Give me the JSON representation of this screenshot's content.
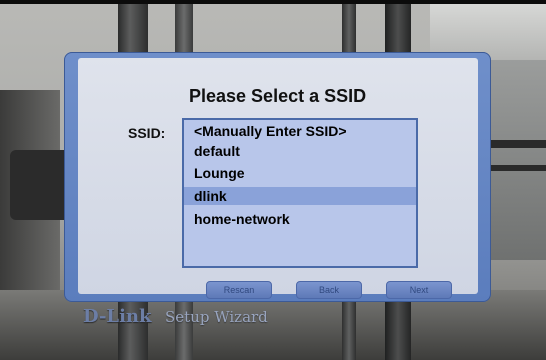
{
  "dialog": {
    "title": "Please Select a SSID",
    "ssid_label": "SSID:",
    "ssid_list": [
      "<Manually Enter SSID>",
      "default",
      "Lounge",
      "dlink",
      "home-network"
    ],
    "selected_ssid": "dlink",
    "buttons": {
      "rescan": "Rescan",
      "back": "Back",
      "next": "Next"
    }
  },
  "branding": {
    "logo": "D-Link",
    "subtitle": "Setup Wizard"
  },
  "colors": {
    "dialog_frame": "#5b7dbd",
    "dialog_body": "#dfe3ec",
    "list_background": "#b8c6ea",
    "selected_row": "#8aa2d9"
  }
}
